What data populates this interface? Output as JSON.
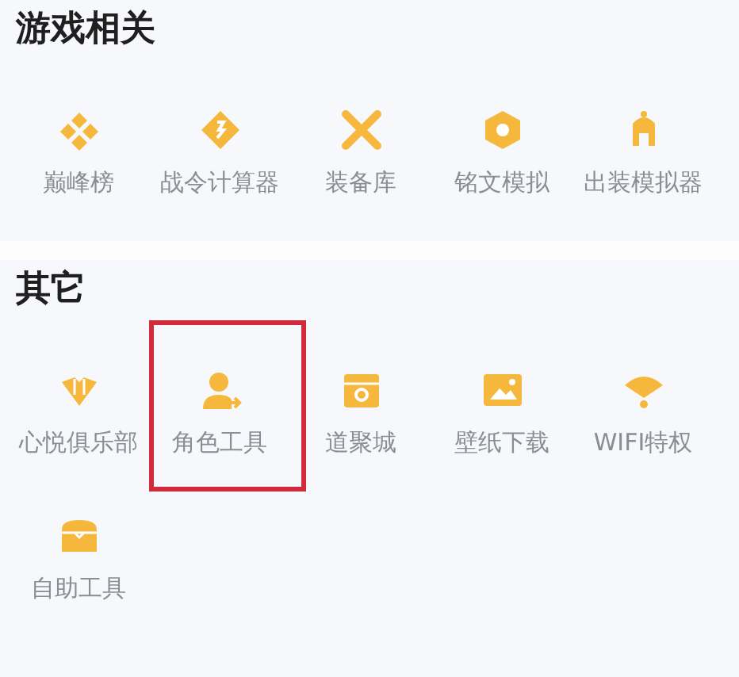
{
  "sections": [
    {
      "title": "游戏相关",
      "items": [
        {
          "label": "巅峰榜",
          "highlighted": false
        },
        {
          "label": "战令计算器",
          "highlighted": false
        },
        {
          "label": "装备库",
          "highlighted": false
        },
        {
          "label": "铭文模拟",
          "highlighted": false
        },
        {
          "label": "出装模拟器",
          "highlighted": false
        }
      ]
    },
    {
      "title": "其它",
      "items": [
        {
          "label": "心悦俱乐部",
          "highlighted": false
        },
        {
          "label": "角色工具",
          "highlighted": true
        },
        {
          "label": "道聚城",
          "highlighted": false
        },
        {
          "label": "壁纸下载",
          "highlighted": false
        },
        {
          "label": "WIFI特权",
          "highlighted": false
        },
        {
          "label": "自助工具",
          "highlighted": false
        }
      ]
    }
  ]
}
